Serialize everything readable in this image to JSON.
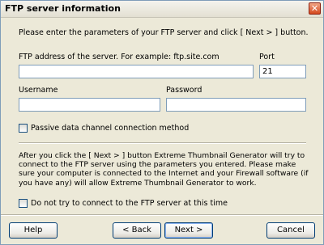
{
  "window": {
    "title": "FTP server information",
    "close_symbol": "✕"
  },
  "intro": "Please enter the parameters of your FTP server and click [ Next > ] button.",
  "fields": {
    "ftp_address_label": "FTP address of the server. For example: ftp.site.com",
    "ftp_address_value": "",
    "port_label": "Port",
    "port_value": "21",
    "username_label": "Username",
    "username_value": "",
    "password_label": "Password",
    "password_value": ""
  },
  "passive_checkbox": {
    "label": "Passive data channel connection method",
    "checked": false
  },
  "info_text": "After you click the [ Next > ] button Extreme Thumbnail Generator will try to connect to the FTP server using the parameters you entered. Please make sure your computer is connected to the Internet and your Firewall software (if you have any) will allow Extreme Thumbnail Generator to work.",
  "skip_checkbox": {
    "label": "Do not try to connect to the FTP server at this time",
    "checked": false
  },
  "buttons": {
    "help": "Help",
    "back": "< Back",
    "next": "Next >",
    "cancel": "Cancel"
  },
  "icons": {
    "close": "close-icon"
  }
}
